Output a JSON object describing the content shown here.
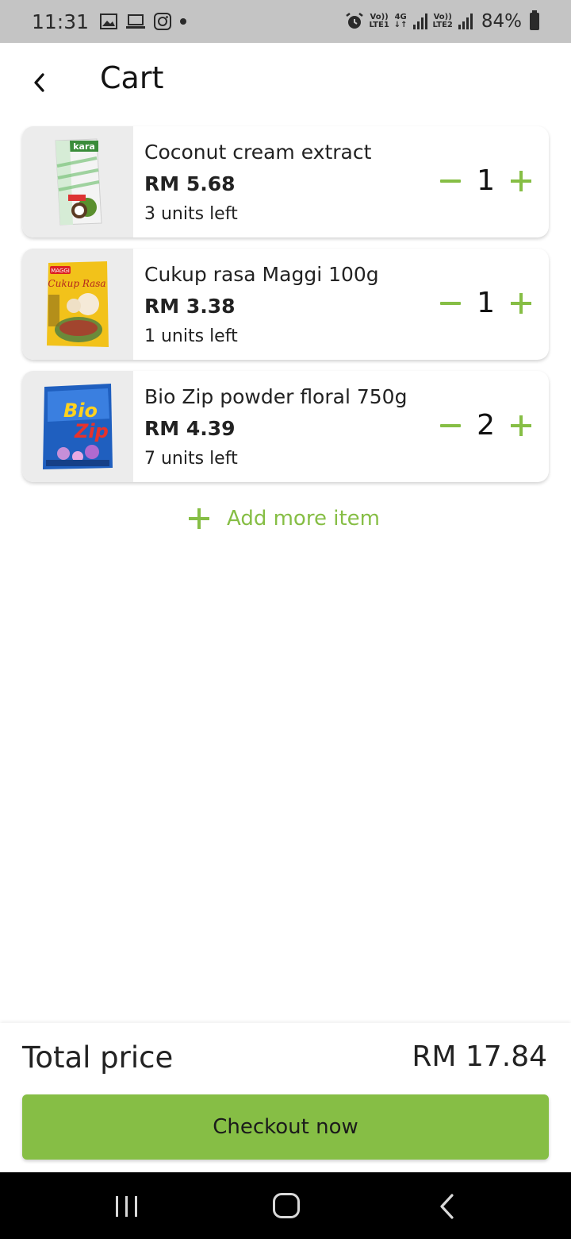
{
  "status_bar": {
    "time": "11:31",
    "left_icons": [
      "gallery-icon",
      "laptop-icon",
      "instagram-icon",
      "dot-icon"
    ],
    "right_icons": [
      "alarm-icon",
      "volte-lte1-icon",
      "signal-4g-icon",
      "volte-lte2-icon",
      "signal-icon",
      "battery-icon"
    ],
    "sim1_top": "Vo))",
    "sim1_bottom": "LTE1",
    "net_top": "4G",
    "net_bottom": "↓↑",
    "sim2_top": "Vo))",
    "sim2_bottom": "LTE2",
    "battery": "84%"
  },
  "header": {
    "back_icon": "chevron-left-icon",
    "title": "Cart"
  },
  "cart": {
    "items": [
      {
        "name": "Coconut cream extract",
        "price": "RM 5.68",
        "stock": "3 units left",
        "quantity": "1",
        "image": "coconut-cream-carton"
      },
      {
        "name": "Cukup rasa Maggi 100g",
        "price": "RM 3.38",
        "stock": "1 units left",
        "quantity": "1",
        "image": "maggi-cukup-rasa-pack"
      },
      {
        "name": "Bio Zip powder floral 750g",
        "price": "RM 4.39",
        "stock": "7 units left",
        "quantity": "2",
        "image": "bio-zip-detergent-pack"
      }
    ],
    "add_more_label": "Add more item"
  },
  "footer": {
    "total_label": "Total price",
    "total_value": "RM 17.84",
    "checkout_label": "Checkout now"
  },
  "colors": {
    "accent": "#86be45",
    "status_bar_bg": "#c4c4c4",
    "thumb_bg": "#ececec",
    "nav_bar_bg": "#000000"
  }
}
